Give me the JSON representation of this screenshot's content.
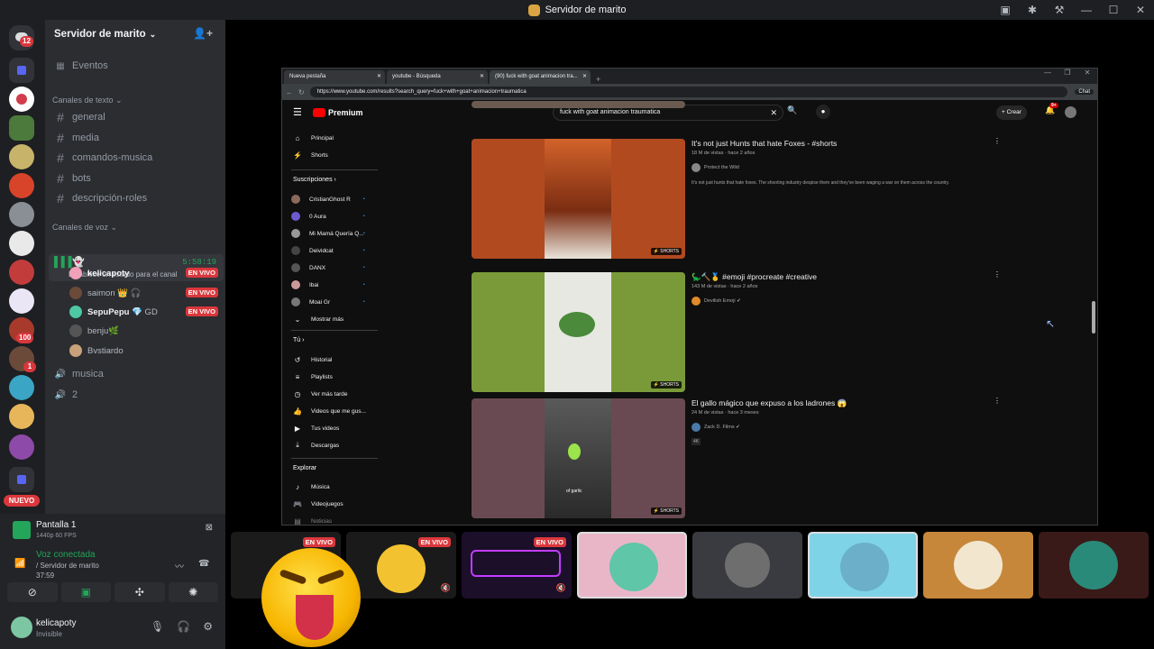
{
  "window": {
    "title": "Servidor de marito"
  },
  "rail": {
    "dm_badge": "12",
    "badge_100": "100",
    "badge_1": "1",
    "nuevo": "NUEVO"
  },
  "server": {
    "name": "Servidor de marito",
    "events": "Eventos",
    "text_category": "Canales de texto",
    "text_channels": [
      "general",
      "media",
      "comandos-musica",
      "bots",
      "descripción-roles"
    ],
    "voice_category": "Canales de voz",
    "active_voice": {
      "time": "5:58:19",
      "status_placeholder": "Establece un estado para el canal"
    },
    "voice_users": [
      {
        "name": "kelicapoty",
        "live": "EN VIVO",
        "bold": true
      },
      {
        "name": "saimon",
        "extra": "👑 🎧",
        "live": "EN VIVO",
        "bold": false
      },
      {
        "name": "SepuPepu",
        "extra": "💎 GD",
        "live": "EN VIVO",
        "bold": true
      },
      {
        "name": "benju",
        "extra": "🌿",
        "live": "",
        "bold": false
      },
      {
        "name": "Bvstiardo",
        "extra": "",
        "live": "",
        "bold": false
      }
    ],
    "other_voice": [
      "musica",
      "2"
    ]
  },
  "panel": {
    "screen_title": "Pantalla 1",
    "screen_sub": "1440p 60 FPS",
    "voice_connected": "Voz conectada",
    "voice_server": "/ Servidor de marito",
    "voice_time": "37:59",
    "user_name": "kelicapoty",
    "user_status": "Invisible"
  },
  "browser": {
    "tabs": [
      "Nueva pestaña",
      "youtube - Búsqueda",
      "(90) fuck with goat animacion tra..."
    ],
    "url": "https://www.youtube.com/results?search_query=fuck+with+goat+animacion+traumatica",
    "chat": "Chat"
  },
  "youtube": {
    "logo": "Premium",
    "search": "fuck with goat animacion traumatica",
    "create": "Crear",
    "notif": "9+",
    "side_main": [
      "Principal",
      "Shorts"
    ],
    "subs_head": "Suscripciones",
    "subs": [
      "CristianGhost R",
      "0 Aura",
      "Mi Mamá Quería Q...",
      "Deividcat",
      "DANX",
      "Ibai",
      "Moai Gr"
    ],
    "more": "Mostrar más",
    "you_head": "Tú",
    "you": [
      "Historial",
      "Playlists",
      "Ver más tarde",
      "Videos que me gus...",
      "Tus videos",
      "Descargas"
    ],
    "explore_head": "Explorar",
    "explore": [
      "Música",
      "Videojuegos",
      "Noticias"
    ],
    "shorts_label": "SHORTS",
    "videos": [
      {
        "title": "It's not just Hunts that hate Foxes - #shorts",
        "meta": "18 M de vistas · hace 2 años",
        "channel": "Protect the Wild",
        "desc": "It's not just hunts that hate foxes. The shooting industry despise them and they've been waging a war on them across the country."
      },
      {
        "title": "🦕🔨🥇 #emoji #procreate #creative",
        "meta": "143 M de vistas · hace 2 años",
        "channel": "Devilish Emoji ✔",
        "desc": ""
      },
      {
        "title": "El gallo mágico que expuso a los ladrones 😱",
        "meta": "24 M de vistas · hace 3 meses",
        "channel": "Zack D. Films ✔",
        "desc": "4K"
      }
    ],
    "video3_caption": "of garlic"
  },
  "strip": {
    "live": "EN VIVO"
  }
}
